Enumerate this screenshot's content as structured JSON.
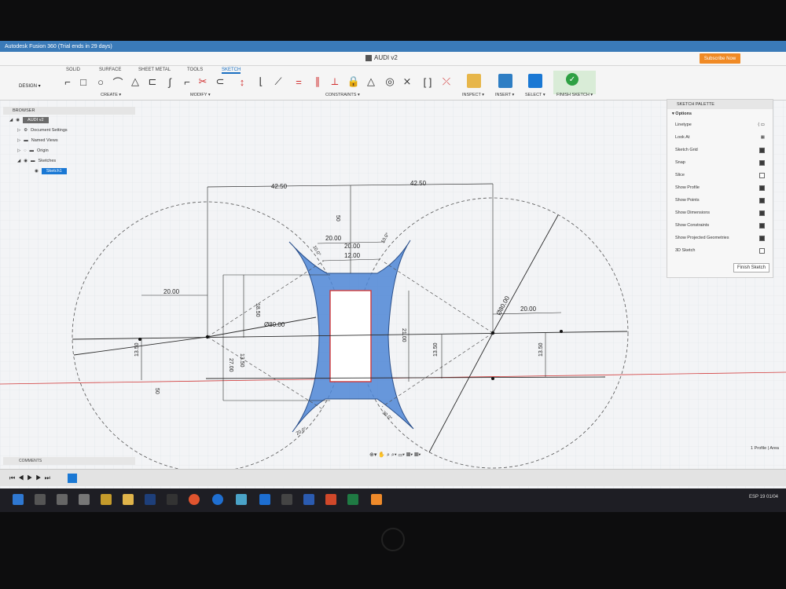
{
  "window": {
    "title": "Autodesk Fusion 360 (Trial ends in 29 days)"
  },
  "document_tab": {
    "name": "AUDI v2"
  },
  "account": {
    "subscribe_label": "Subscribe Now"
  },
  "ribbon": {
    "workspace_tabs": [
      "SOLID",
      "SURFACE",
      "SHEET METAL",
      "TOOLS",
      "SKETCH"
    ],
    "active_tab": "SKETCH",
    "design_label": "DESIGN ▾",
    "groups": {
      "create": "CREATE ▾",
      "modify": "MODIFY ▾",
      "constraints": "CONSTRAINTS ▾",
      "inspect": "INSPECT ▾",
      "insert": "INSERT ▾",
      "select": "SELECT ▾",
      "finish": "FINISH SKETCH ▾"
    }
  },
  "browser": {
    "header": "BROWSER",
    "items": [
      {
        "label": "AUDI v2",
        "selected": false
      },
      {
        "label": "Document Settings",
        "selected": false
      },
      {
        "label": "Named Views",
        "selected": false
      },
      {
        "label": "Origin",
        "selected": false
      },
      {
        "label": "Sketches",
        "selected": false
      },
      {
        "label": "Sketch1",
        "selected": true
      }
    ]
  },
  "palette": {
    "header": "SKETCH PALETTE",
    "section": "▾ Options",
    "options": [
      {
        "label": "Linetype",
        "checked": null
      },
      {
        "label": "Look At",
        "checked": null
      },
      {
        "label": "Sketch Grid",
        "checked": true
      },
      {
        "label": "Snap",
        "checked": true
      },
      {
        "label": "Slice",
        "checked": false
      },
      {
        "label": "Show Profile",
        "checked": true
      },
      {
        "label": "Show Points",
        "checked": true
      },
      {
        "label": "Show Dimensions",
        "checked": true
      },
      {
        "label": "Show Constraints",
        "checked": true
      },
      {
        "label": "Show Projected Geometries",
        "checked": true
      },
      {
        "label": "3D Sketch",
        "checked": false
      }
    ],
    "finish_label": "Finish Sketch"
  },
  "comments": {
    "label": "COMMENTS"
  },
  "status": {
    "profile": "1 Profile | Area"
  },
  "dimensions": {
    "top_left": "42.50",
    "top_right": "42.50",
    "left_h": "20.00",
    "right_h": "20.00",
    "center_top_a": "20.00",
    "center_top_b": "20.00",
    "center_top_c": "12.00",
    "vertical_50_top": "50",
    "vertical_50_left": "50",
    "dia_left": "Ø80.00",
    "dia_right": "Ø80.00",
    "v_18": "18.50",
    "v_27": "27.00",
    "v_13_left_a": "13.50",
    "v_13_left_b": "13.50",
    "v_13_right_a": "13.50",
    "v_13_right_b": "13.50",
    "v_21": "21.00",
    "angle_tl": "10.0°",
    "angle_tr": "10.0°",
    "angle_bl": "20.0°",
    "angle_br": "30.0°"
  },
  "colors": {
    "sketch_line": "#2b2b2b",
    "profile_fill": "#4d86d6",
    "red_axis": "#d13c3c",
    "grid": "#d8dde2"
  },
  "taskbar": {
    "language": "ESP",
    "time": "19",
    "date": "01/04"
  }
}
